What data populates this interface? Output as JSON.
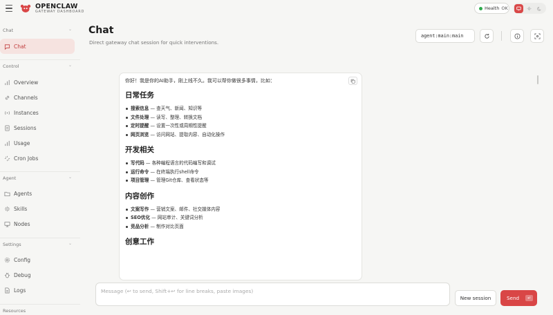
{
  "brand": {
    "name": "OPENCLAW",
    "subtitle": "GATEWAY DASHBOARD",
    "accent": "#d94646"
  },
  "header": {
    "health_label": "Health",
    "health_status": "OK",
    "health_color": "#2eaa4c"
  },
  "sidebar": {
    "sections": [
      {
        "label": "Chat",
        "items": [
          {
            "label": "Chat",
            "icon": "message-square-icon",
            "active": true
          }
        ]
      },
      {
        "label": "Control",
        "items": [
          {
            "label": "Overview",
            "icon": "bar-chart-icon"
          },
          {
            "label": "Channels",
            "icon": "link-icon"
          },
          {
            "label": "Instances",
            "icon": "radio-icon"
          },
          {
            "label": "Sessions",
            "icon": "file-text-icon"
          },
          {
            "label": "Usage",
            "icon": "bar-chart-icon"
          },
          {
            "label": "Cron Jobs",
            "icon": "loader-icon"
          }
        ]
      },
      {
        "label": "Agent",
        "items": [
          {
            "label": "Agents",
            "icon": "folder-icon"
          },
          {
            "label": "Skills",
            "icon": "zap-icon"
          },
          {
            "label": "Nodes",
            "icon": "monitor-icon"
          }
        ]
      },
      {
        "label": "Settings",
        "items": [
          {
            "label": "Config",
            "icon": "settings-icon"
          },
          {
            "label": "Debug",
            "icon": "bug-icon"
          },
          {
            "label": "Logs",
            "icon": "file-icon"
          }
        ]
      },
      {
        "label": "Resources",
        "items": []
      }
    ]
  },
  "page": {
    "title": "Chat",
    "subtitle": "Direct gateway chat session for quick interventions.",
    "session_key": "agent:main:main"
  },
  "message": {
    "intro": "你好！我是你的AI助手，刚上线不久。我可以帮你做很多事情，比如：",
    "sections": [
      {
        "heading": "日常任务",
        "items": [
          {
            "term": "搜索信息",
            "desc": " — 查天气、新闻、知识等"
          },
          {
            "term": "文件处理",
            "desc": " — 读写、整理、转换文档"
          },
          {
            "term": "定时提醒",
            "desc": " — 设置一次性或周期性提醒"
          },
          {
            "term": "网页浏览",
            "desc": " — 访问网站、提取内容、自动化操作"
          }
        ]
      },
      {
        "heading": "开发相关",
        "items": [
          {
            "term": "写代码",
            "desc": " — 各种编程语言的代码编写和调试"
          },
          {
            "term": "运行命令",
            "desc": " — 在终端执行shell命令"
          },
          {
            "term": "项目管理",
            "desc": " — 管理Git仓库、查看状态等"
          }
        ]
      },
      {
        "heading": "内容创作",
        "items": [
          {
            "term": "文案写作",
            "desc": " — 营销文案、邮件、社交媒体内容"
          },
          {
            "term": "SEO优化",
            "desc": " — 网站审计、关键词分析"
          },
          {
            "term": "竞品分析",
            "desc": " — 制作对比页面"
          }
        ]
      },
      {
        "heading": "创意工作",
        "items": []
      }
    ]
  },
  "composer": {
    "placeholder": "Message (↩ to send, Shift+↩ for line breaks, paste images)",
    "new_session_label": "New session",
    "send_label": "Send",
    "send_kbd": "↵"
  }
}
